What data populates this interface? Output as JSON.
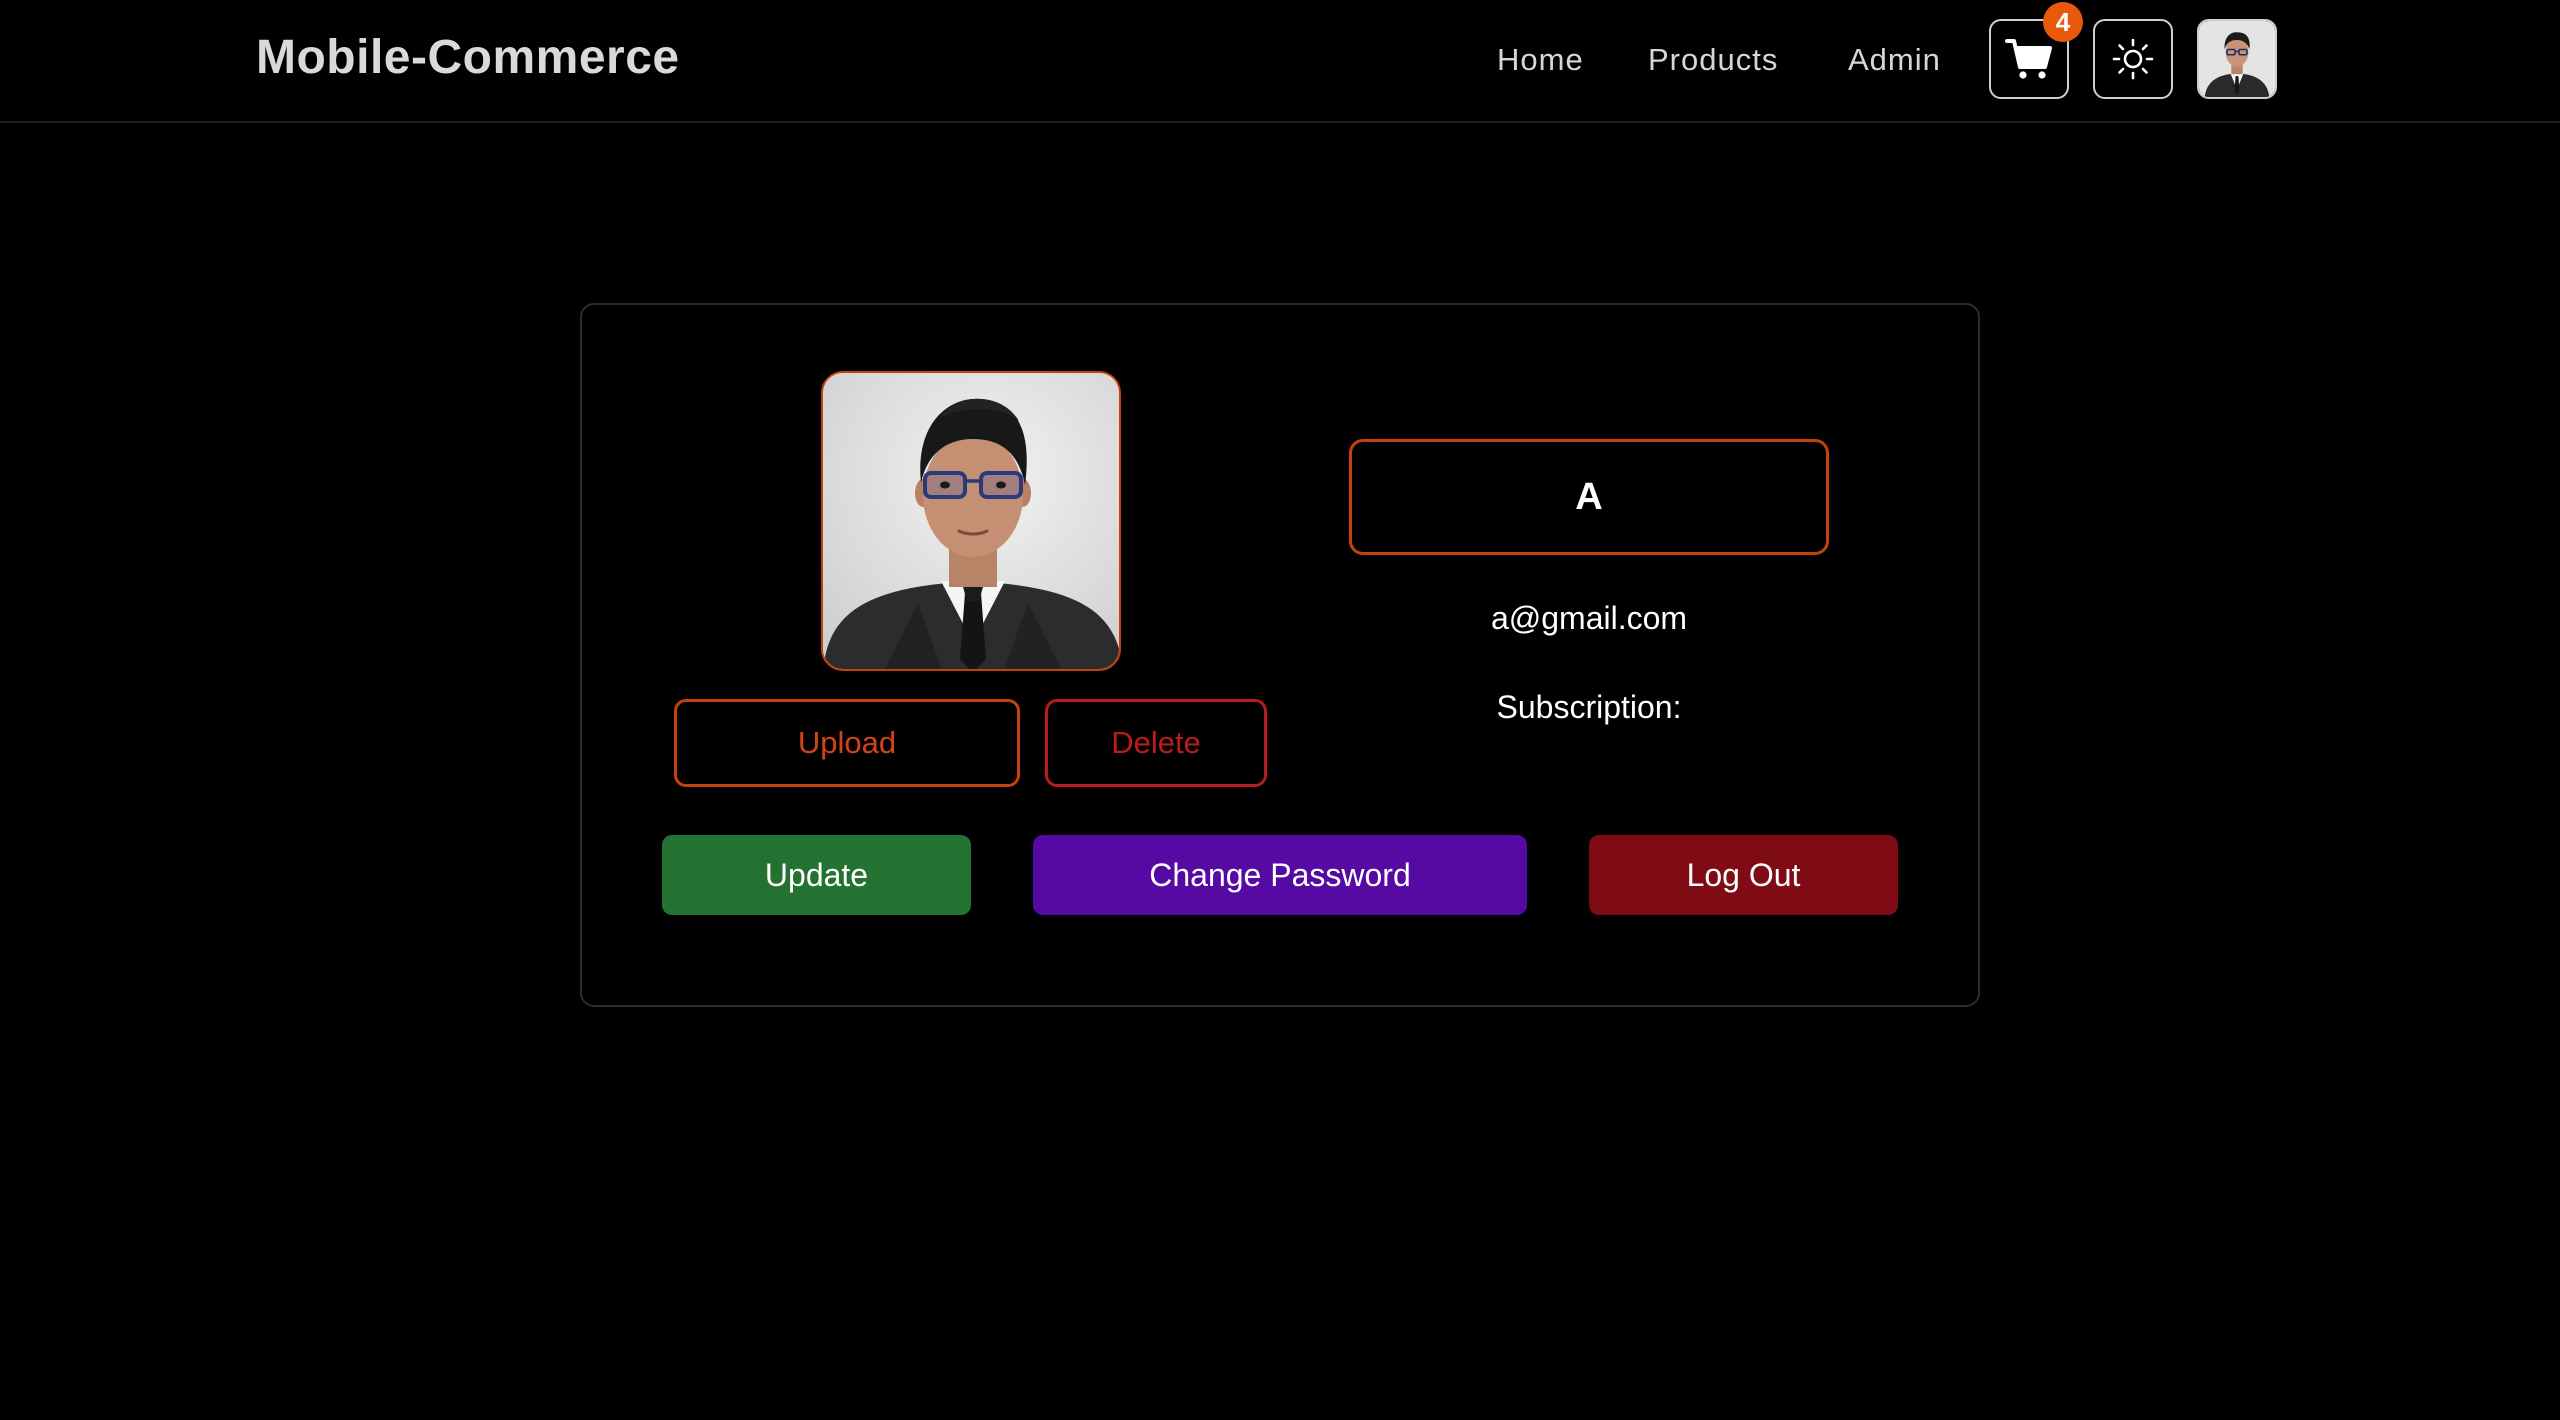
{
  "navbar": {
    "brand": "Mobile-Commerce",
    "links": [
      "Home",
      "Products",
      "Admin"
    ],
    "cart_count": "4",
    "cart_icon": "shopping-cart-icon",
    "theme_icon": "sun-icon",
    "avatar_icon": "user-avatar"
  },
  "profile": {
    "name": "A",
    "email": "a@gmail.com",
    "subscription_label": "Subscription:",
    "upload_label": "Upload",
    "delete_label": "Delete",
    "update_label": "Update",
    "change_password_label": "Change Password",
    "logout_label": "Log Out"
  },
  "colors": {
    "accent_orange": "#c2410c",
    "update_green": "#237231",
    "password_purple": "#560aa3",
    "logout_red": "#7f0c14",
    "badge_orange": "#e8590c"
  }
}
